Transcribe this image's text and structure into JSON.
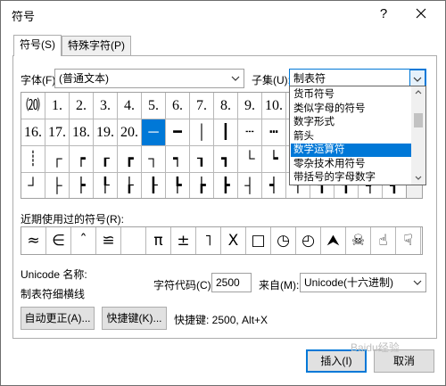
{
  "window": {
    "title": "符号",
    "help_label": "?"
  },
  "tabs": [
    {
      "label": "符号(S)"
    },
    {
      "label": "特殊字符(P)"
    }
  ],
  "font": {
    "label": "字体(F):",
    "value": "(普通文本)"
  },
  "subset": {
    "label": "子集(U):",
    "value": "制表符",
    "options": [
      "货币符号",
      "类似字母的符号",
      "数字形式",
      "箭头",
      "数学运算符",
      "零杂技术用符号",
      "带括号的字母数字"
    ],
    "selected_option": "数学运算符"
  },
  "symbol_grid": {
    "rows": [
      [
        "⒇",
        "1.",
        "2.",
        "3.",
        "4.",
        "5.",
        "6.",
        "7.",
        "8.",
        "9.",
        "10.",
        "",
        "",
        "",
        "",
        ""
      ],
      [
        "16.",
        "17.",
        "18.",
        "19.",
        "20.",
        "─",
        "━",
        "│",
        "┃",
        "┄",
        "┅",
        "",
        "",
        "",
        "",
        ""
      ],
      [
        "┊",
        "┌",
        "┍",
        "┎",
        "┏",
        "┐",
        "┑",
        "┒",
        "┓",
        "└",
        "┕",
        "┖",
        "┗",
        "",
        "",
        ""
      ],
      [
        "┘",
        "├",
        "┝",
        "┞",
        "┟",
        "┠",
        "┡",
        "┢",
        "┣",
        "┤",
        "┥",
        "┦",
        "┧",
        "┨",
        "┩",
        "┪"
      ]
    ],
    "selected": "─"
  },
  "recent": {
    "label": "近期使用过的符号(R):",
    "symbols": [
      "≈",
      "∈",
      "ˆ",
      "≌",
      "",
      "π",
      "±",
      "˥",
      "Χ",
      "□",
      "◷",
      "◴",
      "⮝",
      "☠",
      "☝",
      "☟"
    ]
  },
  "unicode_name": {
    "label": "Unicode 名称:",
    "value": "制表符细横线"
  },
  "char_code": {
    "label": "字符代码(C):",
    "value": "2500"
  },
  "from": {
    "label": "来自(M):",
    "value": "Unicode(十六进制)"
  },
  "buttons": {
    "autocorrect": "自动更正(A)...",
    "shortcut_key": "快捷键(K)...",
    "shortcut_info": "快捷键: 2500, Alt+X",
    "insert": "插入(I)",
    "cancel": "取消"
  },
  "watermark": "Baidu经验"
}
